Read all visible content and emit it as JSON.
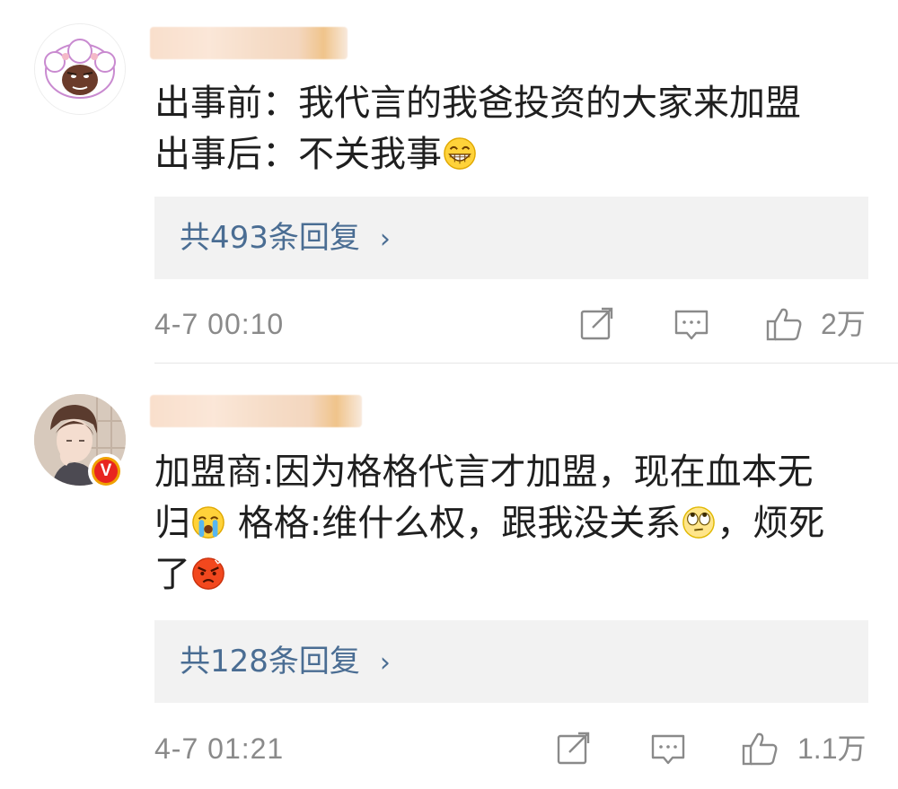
{
  "comments": [
    {
      "lines": [
        "出事前：我代言的我爸投资的大家来加盟",
        "出事后：不关我事"
      ],
      "emojis": [
        "grin-emoji"
      ],
      "reply_label": "共493条回复",
      "reply_chevron": "›",
      "timestamp": "4-7 00:10",
      "likes": "2万",
      "verified": false
    },
    {
      "lines": [
        "加盟商:因为格格代言才加盟，现在血本无",
        "归",
        "格格:维什么权，跟我没关系",
        "，烦死",
        "了"
      ],
      "emojis": [
        "crying-emoji",
        "eye-roll-emoji",
        "angry-emoji"
      ],
      "reply_label": "共128条回复",
      "reply_chevron": "›",
      "timestamp": "4-7 01:21",
      "likes": "1.1万",
      "verified": true,
      "verified_mark": "V"
    }
  ],
  "colors": {
    "link": "#4a6d93",
    "meta": "#8a8a8a",
    "reply_bg": "#f2f2f2",
    "badge_red": "#e8251f",
    "badge_gold": "#f0a000"
  },
  "icons": [
    "share-icon",
    "comment-icon",
    "like-icon"
  ]
}
